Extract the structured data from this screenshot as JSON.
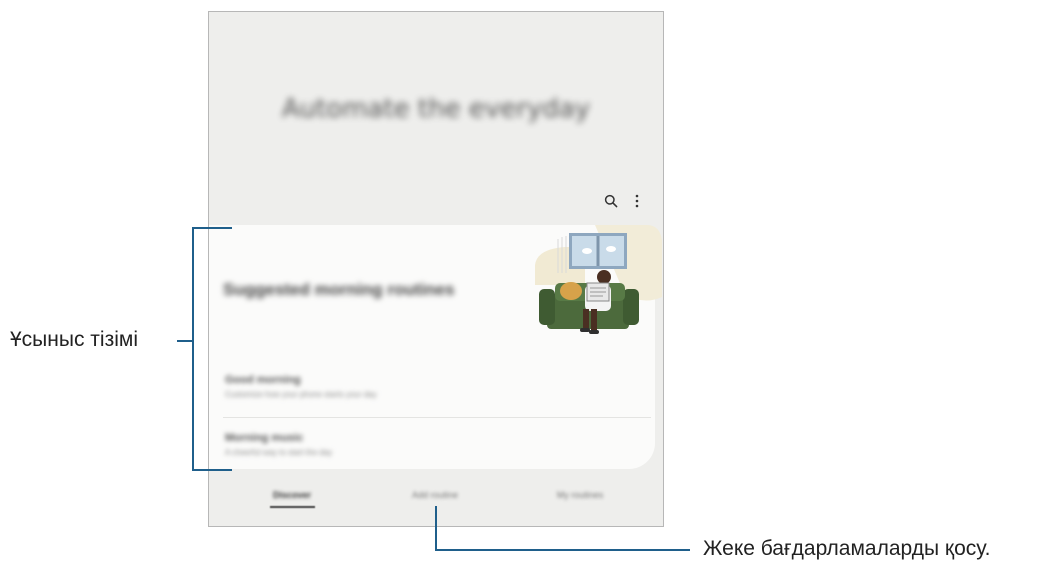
{
  "hero": {
    "title": "Automate the everyday"
  },
  "toolbar": {
    "search_icon": "search-icon",
    "more_icon": "more-vertical-icon"
  },
  "suggestions": {
    "title": "Suggested morning routines",
    "items": [
      {
        "name": "Good morning",
        "description": "Customize how your phone starts your day"
      },
      {
        "name": "Morning music",
        "description": "A cheerful way to start the day"
      }
    ]
  },
  "tabs": [
    {
      "label": "Discover",
      "selected": true
    },
    {
      "label": "Add routine",
      "selected": false
    },
    {
      "label": "My routines",
      "selected": false
    }
  ],
  "callouts": {
    "suggestion_list": "Ұсыныс тізімі",
    "add_routine": "Жеке бағдарламаларды қосу."
  },
  "colors": {
    "screen_bg": "#eeeeec",
    "card_bg": "#fbfbfa",
    "callout_line": "#1f5f8b",
    "sofa": "#4c6a3c"
  }
}
